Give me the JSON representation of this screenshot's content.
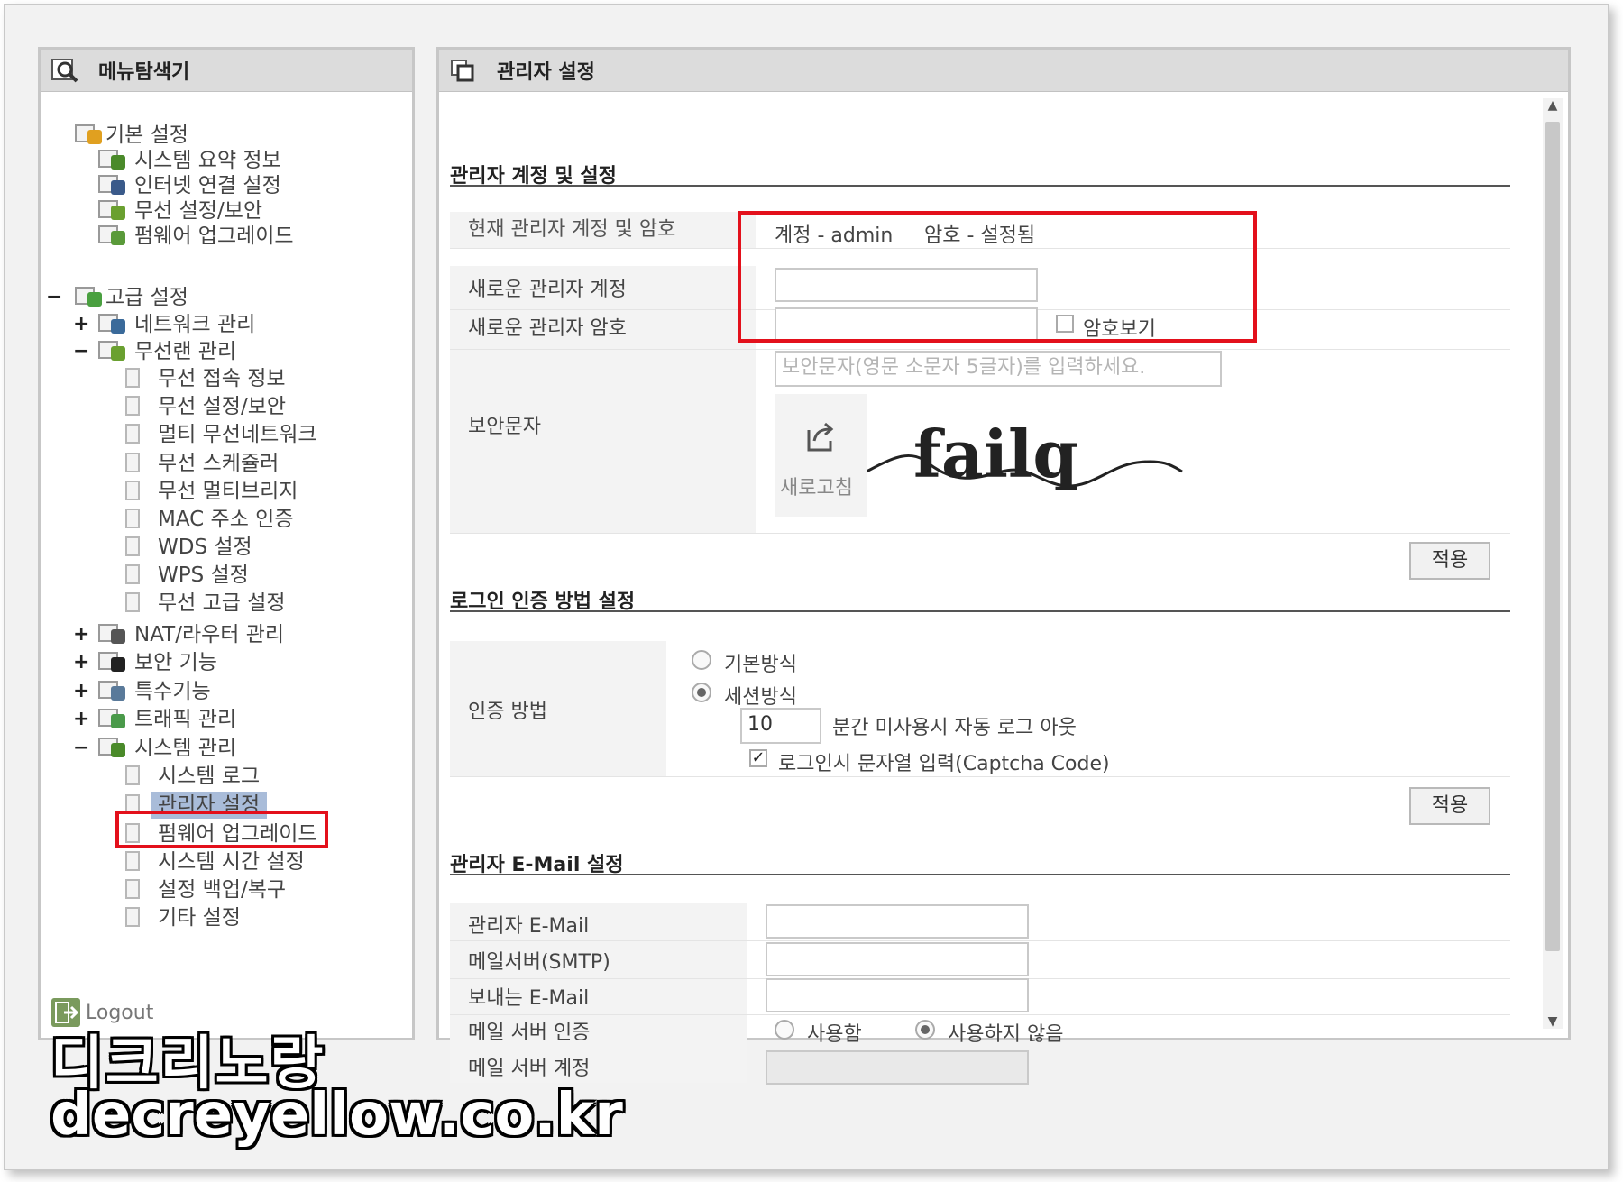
{
  "left_panel": {
    "title": "메뉴탐색기",
    "logout": "Logout",
    "tree": [
      {
        "label": "기본 설정",
        "toggle": "",
        "type": "folder",
        "level": 0,
        "badge": "#e0a020"
      },
      {
        "label": "시스템 요약 정보",
        "toggle": "",
        "type": "leaf-icon",
        "level": 1,
        "badge": "#4a8a2a"
      },
      {
        "label": "인터넷 연결 설정",
        "toggle": "",
        "type": "leaf-icon",
        "level": 1,
        "badge": "#3a5a8a"
      },
      {
        "label": "무선 설정/보안",
        "toggle": "",
        "type": "leaf-icon",
        "level": 1,
        "badge": "#6aa030"
      },
      {
        "label": "펌웨어 업그레이드",
        "toggle": "",
        "type": "leaf-icon",
        "level": 1,
        "badge": "#5a9a3a"
      },
      {
        "label": "고급 설정",
        "toggle": "−",
        "type": "folder",
        "level": 0,
        "badge": "#4aa040"
      },
      {
        "label": "네트워크 관리",
        "toggle": "+",
        "type": "folder",
        "level": 1,
        "badge": "#3a6a9a"
      },
      {
        "label": "무선랜 관리",
        "toggle": "−",
        "type": "folder",
        "level": 1,
        "badge": "#6aa030"
      },
      {
        "label": "무선 접속 정보",
        "toggle": "",
        "type": "page",
        "level": 2
      },
      {
        "label": "무선 설정/보안",
        "toggle": "",
        "type": "page",
        "level": 2
      },
      {
        "label": "멀티 무선네트워크",
        "toggle": "",
        "type": "page",
        "level": 2
      },
      {
        "label": "무선 스케쥴러",
        "toggle": "",
        "type": "page",
        "level": 2
      },
      {
        "label": "무선 멀티브리지",
        "toggle": "",
        "type": "page",
        "level": 2
      },
      {
        "label": "MAC 주소 인증",
        "toggle": "",
        "type": "page",
        "level": 2
      },
      {
        "label": "WDS 설정",
        "toggle": "",
        "type": "page",
        "level": 2
      },
      {
        "label": "WPS 설정",
        "toggle": "",
        "type": "page",
        "level": 2
      },
      {
        "label": "무선 고급 설정",
        "toggle": "",
        "type": "page",
        "level": 2
      },
      {
        "label": "NAT/라우터 관리",
        "toggle": "+",
        "type": "folder",
        "level": 1,
        "badge": "#555555"
      },
      {
        "label": "보안 기능",
        "toggle": "+",
        "type": "folder",
        "level": 1,
        "badge": "#222222"
      },
      {
        "label": "특수기능",
        "toggle": "+",
        "type": "folder",
        "level": 1,
        "badge": "#5a7a9a"
      },
      {
        "label": "트래픽 관리",
        "toggle": "+",
        "type": "folder",
        "level": 1,
        "badge": "#4a9a4a"
      },
      {
        "label": "시스템 관리",
        "toggle": "−",
        "type": "folder",
        "level": 1,
        "badge": "#4a8a2a"
      },
      {
        "label": "시스템 로그",
        "toggle": "",
        "type": "page",
        "level": 2
      },
      {
        "label": "관리자 설정",
        "toggle": "",
        "type": "page",
        "level": 2,
        "selected": true
      },
      {
        "label": "펌웨어 업그레이드",
        "toggle": "",
        "type": "page",
        "level": 2
      },
      {
        "label": "시스템 시간 설정",
        "toggle": "",
        "type": "page",
        "level": 2
      },
      {
        "label": "설정 백업/복구",
        "toggle": "",
        "type": "page",
        "level": 2
      },
      {
        "label": "기타 설정",
        "toggle": "",
        "type": "page",
        "level": 2
      }
    ]
  },
  "right_panel": {
    "title": "관리자 설정",
    "account_section": {
      "title": "관리자 계정 및 설정",
      "current_label": "현재 관리자 계정 및 암호",
      "current_account": "계정 - admin",
      "current_password": "암호 - 설정됨",
      "new_account_label": "새로운 관리자 계정",
      "new_account_value": "",
      "new_password_label": "새로운 관리자 암호",
      "new_password_value": "",
      "show_password_label": "암호보기",
      "captcha_label": "보안문자",
      "captcha_placeholder": "보안문자(영문 소문자 5글자)를 입력하세요.",
      "refresh_label": "새로고침",
      "captcha_text": "failq",
      "apply": "적용"
    },
    "login_section": {
      "title": "로그인 인증 방법 설정",
      "method_label": "인증 방법",
      "option_basic": "기본방식",
      "option_session": "세션방식",
      "selected": "세션방식",
      "timeout_value": "10",
      "timeout_suffix": "분간 미사용시 자동 로그 아웃",
      "captcha_checkbox_label": "로그인시 문자열 입력(Captcha Code)",
      "captcha_checked": true,
      "apply": "적용"
    },
    "email_section": {
      "title": "관리자 E-Mail 설정",
      "admin_email_label": "관리자 E-Mail",
      "admin_email_value": "",
      "smtp_label": "메일서버(SMTP)",
      "smtp_value": "",
      "sender_label": "보내는 E-Mail",
      "sender_value": "",
      "auth_label": "메일 서버 인증",
      "auth_use": "사용함",
      "auth_not_use": "사용하지 않음",
      "auth_selected": "사용하지 않음",
      "account_label": "메일 서버 계정",
      "account_value": ""
    }
  },
  "watermark": {
    "line1": "디크리노랑",
    "line2": "decreyellow.co.kr"
  },
  "colors": {
    "highlight_box": "#e3101b",
    "selected_item": "#a9bcd9",
    "header_bg": "#dcdcdc"
  }
}
